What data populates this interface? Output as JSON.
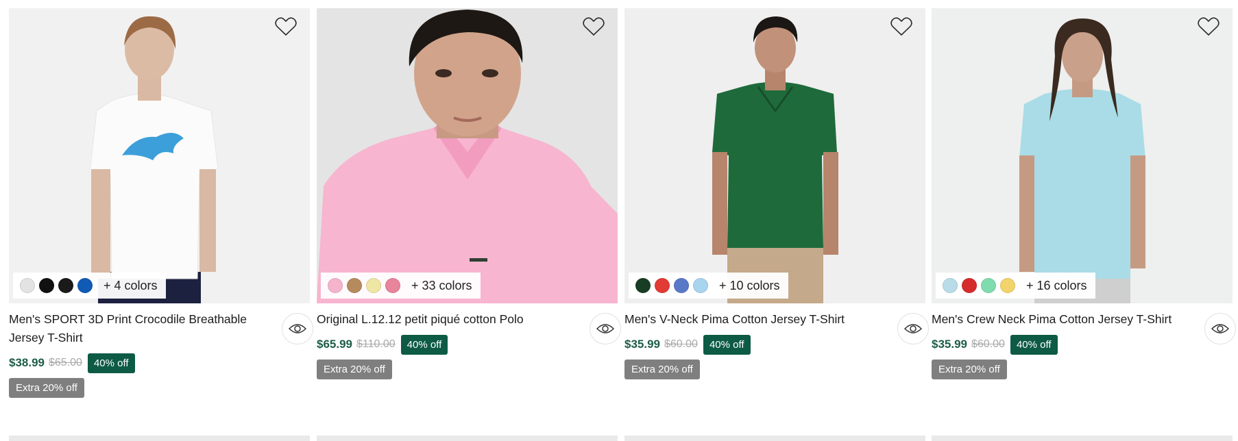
{
  "products": [
    {
      "title": "Men's SPORT 3D Print Crocodile Breathable Jersey T-Shirt",
      "price": "$38.99",
      "old_price": "$65.00",
      "discount": "40% off",
      "extra": "Extra 20% off",
      "swatches": [
        "#e3e3e3",
        "#111111",
        "#1a1a1a",
        "#0f5bb5"
      ],
      "more_colors": "+ 4 colors",
      "image": "model-white-crocodile-tshirt"
    },
    {
      "title": "Original L.12.12 petit piqué cotton Polo",
      "price": "$65.99",
      "old_price": "$110.00",
      "discount": "40% off",
      "extra": "Extra 20% off",
      "swatches": [
        "#f5b3cc",
        "#b58b5e",
        "#f0e6a3",
        "#e8849c"
      ],
      "more_colors": "+ 33 colors",
      "image": "model-pink-polo"
    },
    {
      "title": "Men's V-Neck Pima Cotton Jersey T-Shirt",
      "price": "$35.99",
      "old_price": "$60.00",
      "discount": "40% off",
      "extra": "Extra 20% off",
      "swatches": [
        "#173d24",
        "#e23a35",
        "#5a78c8",
        "#a9d4f0"
      ],
      "more_colors": "+ 10 colors",
      "image": "model-green-vneck"
    },
    {
      "title": "Men's Crew Neck Pima Cotton Jersey T-Shirt",
      "price": "$35.99",
      "old_price": "$60.00",
      "discount": "40% off",
      "extra": "Extra 20% off",
      "swatches": [
        "#b9dde8",
        "#d62b2b",
        "#7fdcae",
        "#f3d36b"
      ],
      "more_colors": "+ 16 colors",
      "image": "model-light-blue-crewneck"
    }
  ]
}
